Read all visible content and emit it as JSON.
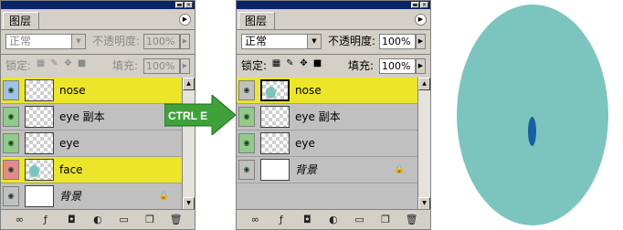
{
  "colors": {
    "highlight_yellow": "#ede628",
    "face_teal": "#7cc5bf",
    "nose_blue": "#17609f",
    "eye_blue": "#9dc3e6",
    "eye_green": "#8fcc8a",
    "eye_red": "#e38b8b",
    "arrow_green": "#3fa13a"
  },
  "left_panel": {
    "tab_label": "图层",
    "blend_mode": "正常",
    "opacity_label": "不透明度:",
    "opacity_value": "100%",
    "lock_label": "锁定:",
    "fill_label": "填充:",
    "fill_value": "100%",
    "layers": [
      {
        "name": "nose",
        "selected": true,
        "eye_color": "blue",
        "thumb": "checker"
      },
      {
        "name": "eye 副本",
        "selected": false,
        "eye_color": "green",
        "thumb": "checker"
      },
      {
        "name": "eye",
        "selected": false,
        "eye_color": "green",
        "thumb": "checker"
      },
      {
        "name": "face",
        "selected": true,
        "eye_color": "red",
        "thumb": "blob"
      },
      {
        "name": "背景",
        "selected": false,
        "eye_color": "none",
        "thumb": "white",
        "locked": true
      }
    ]
  },
  "right_panel": {
    "tab_label": "图层",
    "blend_mode": "正常",
    "opacity_label": "不透明度:",
    "opacity_value": "100%",
    "lock_label": "锁定:",
    "fill_label": "填充:",
    "fill_value": "100%",
    "layers": [
      {
        "name": "nose",
        "selected": true,
        "thumb": "blob"
      },
      {
        "name": "eye 副本",
        "selected": false,
        "thumb": "checker"
      },
      {
        "name": "eye",
        "selected": false,
        "thumb": "checker"
      },
      {
        "name": "背景",
        "selected": false,
        "thumb": "white",
        "locked": true
      }
    ]
  },
  "arrow_label": "CTRL E",
  "footer_icons": [
    "link-icon",
    "layer-style-icon",
    "mask-icon",
    "adjustment-icon",
    "group-folder-icon",
    "new-layer-icon",
    "trash-icon"
  ]
}
